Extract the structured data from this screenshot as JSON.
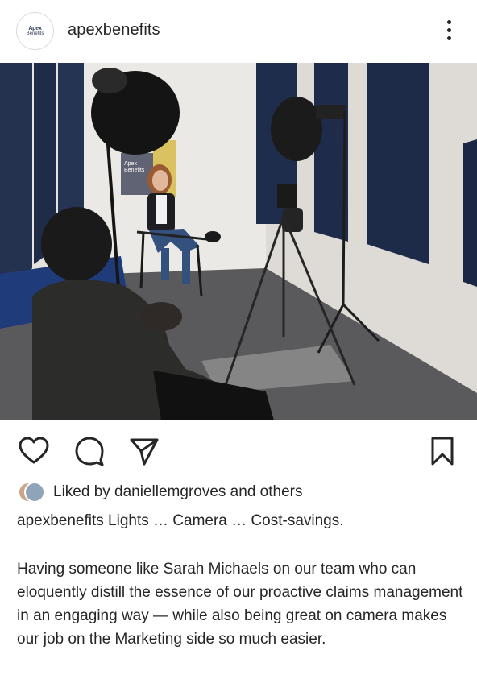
{
  "post": {
    "author": {
      "username": "apexbenefits",
      "avatar_logo_line1": "Apex",
      "avatar_logo_line2": "Benefits"
    },
    "more_icon": "more-vertical-icon",
    "photo": {
      "sign_line1": "Apex",
      "sign_line2": "Benefits"
    },
    "actions": {
      "like_icon": "heart-icon",
      "comment_icon": "comment-icon",
      "share_icon": "send-icon",
      "save_icon": "bookmark-icon"
    },
    "likes": {
      "prefix": "Liked by ",
      "user": "daniellemgroves",
      "suffix": " and others"
    },
    "caption": {
      "username": "apexbenefits",
      "headline": "Lights … Camera … Cost-savings.",
      "body": "Having someone like Sarah Michaels on our team who can eloquently distill the essence of our proactive claims management in an engaging way — while also being great on camera makes our job on the Marketing side so much easier."
    }
  },
  "colors": {
    "text": "#262626",
    "wall_panel": "#1f2d4d",
    "wall": "#e9e7e3",
    "carpet": "#5d5d5f"
  }
}
